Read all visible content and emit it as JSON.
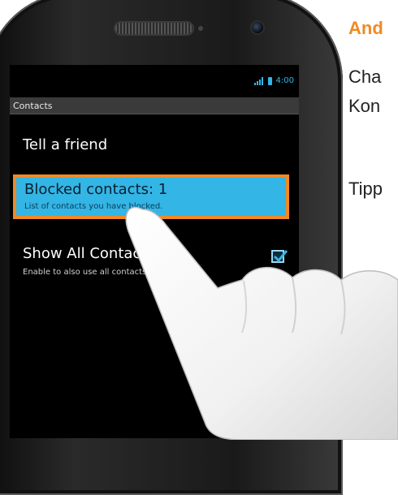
{
  "side": {
    "heading": "And",
    "line1": "Cha",
    "line2": "Kon",
    "line3": "Tipp"
  },
  "status": {
    "time": "4:00"
  },
  "action_bar": {
    "title": "Contacts"
  },
  "menu": {
    "items": [
      {
        "title": "Tell a friend"
      },
      {
        "title": "Blocked contacts: 1",
        "subtitle": "List of contacts you have blocked."
      },
      {
        "title": "Show All Contacts",
        "subtitle": "Enable to also use all contacts",
        "checked": true
      }
    ]
  },
  "colors": {
    "accent_blue": "#33b5e5",
    "highlight_orange": "#f08a24"
  },
  "icons": [
    "signal-icon",
    "battery-icon",
    "checkbox-checked-icon",
    "pointing-hand-icon"
  ]
}
